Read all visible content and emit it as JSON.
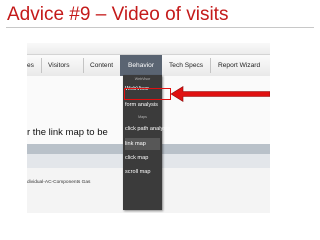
{
  "slide": {
    "title": "Advice #9 – Video of visits"
  },
  "nav": {
    "tabs": [
      "es",
      "Visitors",
      "Content",
      "Behavior",
      "Tech Specs",
      "Report Wizard"
    ],
    "active_tab": "Behavior"
  },
  "behavior_menu": {
    "section_webvisor": "WebVisor",
    "item_webvisor": "WebVisor",
    "item_form_analysis": "form analysis",
    "section_maps": "Maps",
    "item_click_path": "click path analysis",
    "item_link_map": "link map",
    "item_click_map": "click map",
    "item_scroll_map": "scroll map"
  },
  "page": {
    "lead_text": "r the link map to be",
    "url_fragment": "dividual-AC-Components   Gas"
  },
  "colors": {
    "title": "#c41a1a",
    "menu_bg": "#3b3b3b",
    "highlight_arrow": "#e01010",
    "active_tab_bg": "#5a6472"
  }
}
